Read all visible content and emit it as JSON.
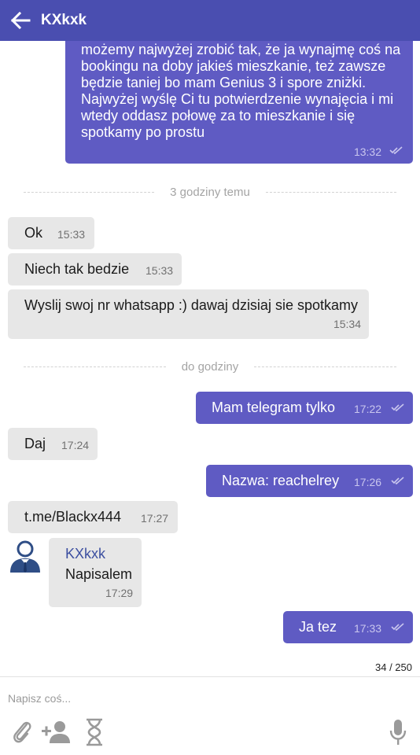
{
  "header": {
    "title": "KXkxk",
    "back_icon": "arrow-left-icon",
    "color": "#4a4eb0"
  },
  "colors": {
    "outgoing": "#5f5bc3",
    "incoming": "#e7e7e7"
  },
  "messages": [
    {
      "direction": "out",
      "lines": [
        "możemy najwyżej zrobić tak, że ja wynajmę coś na",
        "bookingu na doby jakieś mieszkanie, też zawsze",
        "będzie taniej bo mam Genius 3 i spore zniżki.",
        "Najwyżej wyślę Ci tu potwierdzenie wynajęcia i mi",
        "wtedy oddasz połowę za to mieszkanie i się",
        "spotkamy po prostu"
      ],
      "time": "13:32"
    },
    {
      "direction": "in",
      "text": "Ok",
      "time": "15:33"
    },
    {
      "direction": "in",
      "text": "Niech tak bedzie",
      "time": "15:33"
    },
    {
      "direction": "in",
      "text": "Wyslij swoj nr whatsapp :) dawaj dzisiaj sie spotkamy",
      "time": "15:34"
    },
    {
      "direction": "out",
      "text": "Mam telegram tylko",
      "time": "17:22"
    },
    {
      "direction": "in",
      "text": "Daj",
      "time": "17:24"
    },
    {
      "direction": "out",
      "text": "Nazwa: reachelrey",
      "time": "17:26"
    },
    {
      "direction": "in",
      "text": "t.me/Blackx444",
      "time": "17:27"
    },
    {
      "direction": "in",
      "sender": "KXkxk",
      "text": "Napisalem",
      "time": "17:29"
    },
    {
      "direction": "out",
      "text": "Ja tez",
      "time": "17:33"
    }
  ],
  "dividers": [
    "3 godziny temu",
    "do godziny"
  ],
  "composer": {
    "placeholder": "Napisz coś...",
    "counter": "34 / 250"
  },
  "icons": [
    "paperclip-icon",
    "add-contact-icon",
    "hourglass-icon",
    "microphone-icon"
  ]
}
